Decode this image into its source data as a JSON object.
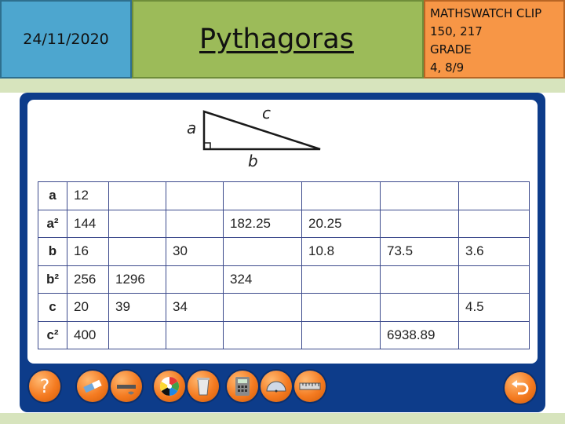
{
  "header": {
    "date": "24/11/2020",
    "title": "Pythagoras",
    "clip_lines": [
      "MATHSWATCH CLIP",
      "150, 217",
      "GRADE",
      "4, 8/9"
    ]
  },
  "diagram": {
    "side_a": "a",
    "side_b": "b",
    "side_c": "c"
  },
  "table": {
    "rows": [
      {
        "head": "a",
        "cells": [
          "12",
          "",
          "",
          "",
          "",
          "",
          ""
        ]
      },
      {
        "head": "a²",
        "cells": [
          "144",
          "",
          "",
          "182.25",
          "20.25",
          "",
          ""
        ]
      },
      {
        "head": "b",
        "cells": [
          "16",
          "",
          "30",
          "",
          "10.8",
          "73.5",
          "3.6"
        ]
      },
      {
        "head": "b²",
        "cells": [
          "256",
          "1296",
          "",
          "324",
          "",
          "",
          ""
        ]
      },
      {
        "head": "c",
        "cells": [
          "20",
          "39",
          "34",
          "",
          "",
          "",
          "4.5"
        ]
      },
      {
        "head": "c²",
        "cells": [
          "400",
          "",
          "",
          "",
          "",
          "6938.89",
          ""
        ]
      }
    ]
  },
  "toolbar": {
    "help": "?",
    "tools": [
      "eraser-icon",
      "ruler-pen-icon",
      "colour-wheel-icon",
      "bin-icon",
      "calculator-icon",
      "protractor-icon",
      "ruler-icon"
    ],
    "back": "back-arrow-icon",
    "colors": {
      "frame": "#0d3c8a",
      "button": "#f47a20"
    }
  }
}
